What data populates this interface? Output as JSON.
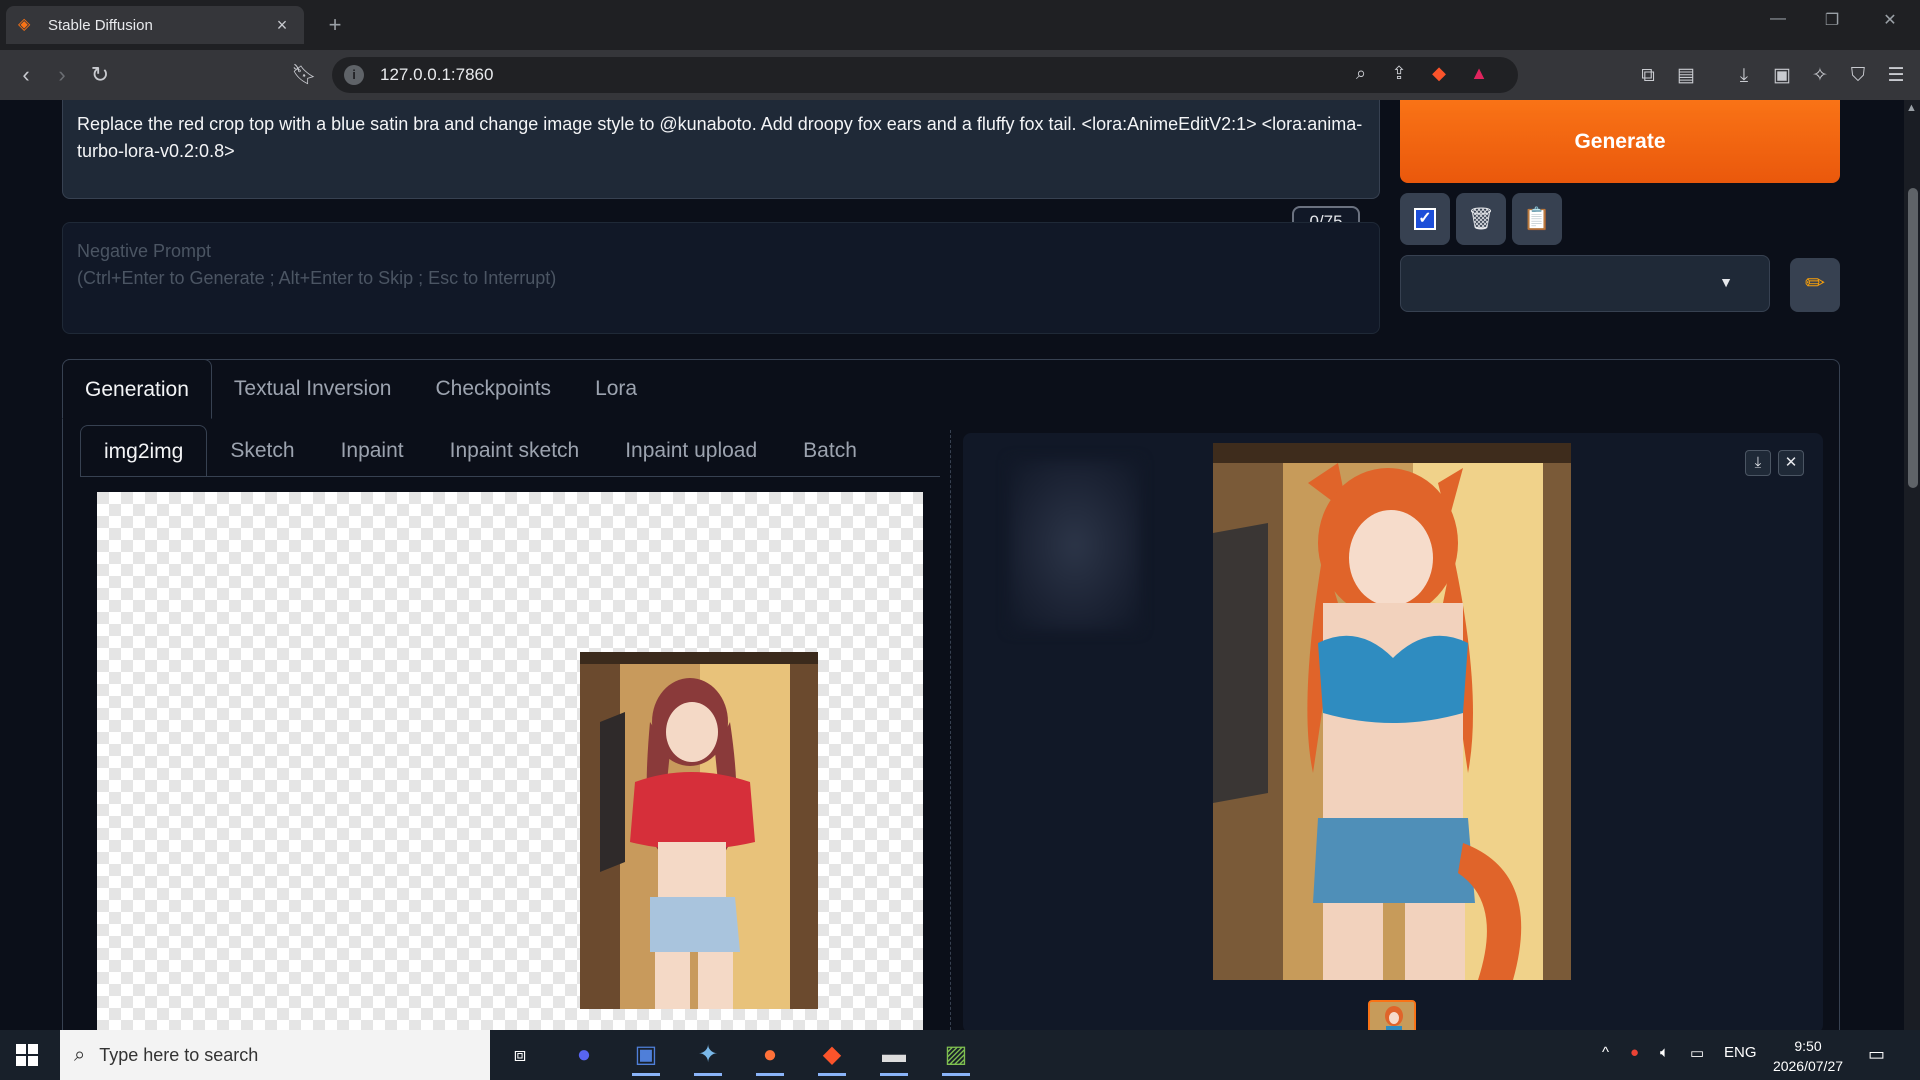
{
  "browser": {
    "tab_title": "Stable Diffusion",
    "url": "127.0.0.1:7860"
  },
  "prompt": {
    "text": "Replace the red crop top with a blue satin bra and change image style to @kunaboto. Add droopy fox ears and a fluffy fox tail. <lora:AnimeEditV2:1> <lora:anima-turbo-lora-v0.2:0.8>",
    "token_counter": "0/75"
  },
  "negative_prompt": {
    "label": "Negative Prompt",
    "hint": "(Ctrl+Enter to Generate ; Alt+Enter to Skip ; Esc to Interrupt)"
  },
  "actions": {
    "generate_label": "Generate",
    "checkbox_icon": "✓",
    "trash_icon": "🗑",
    "clipboard_icon": "📋",
    "edit_icon": "✏",
    "style_select_value": ""
  },
  "main_tabs": [
    "Generation",
    "Textual Inversion",
    "Checkpoints",
    "Lora"
  ],
  "sub_tabs": [
    "img2img",
    "Sketch",
    "Inpaint",
    "Inpaint sketch",
    "Inpaint upload",
    "Batch"
  ],
  "output_controls": {
    "download_icon": "⤓",
    "close_icon": "✕"
  },
  "taskbar": {
    "search_placeholder": "Type here to search",
    "language": "ENG",
    "time": "9:50",
    "date": "2026/07/27"
  },
  "colors": {
    "accent": "#f97316",
    "background": "#0b0f19",
    "panel": "#1f2937"
  }
}
